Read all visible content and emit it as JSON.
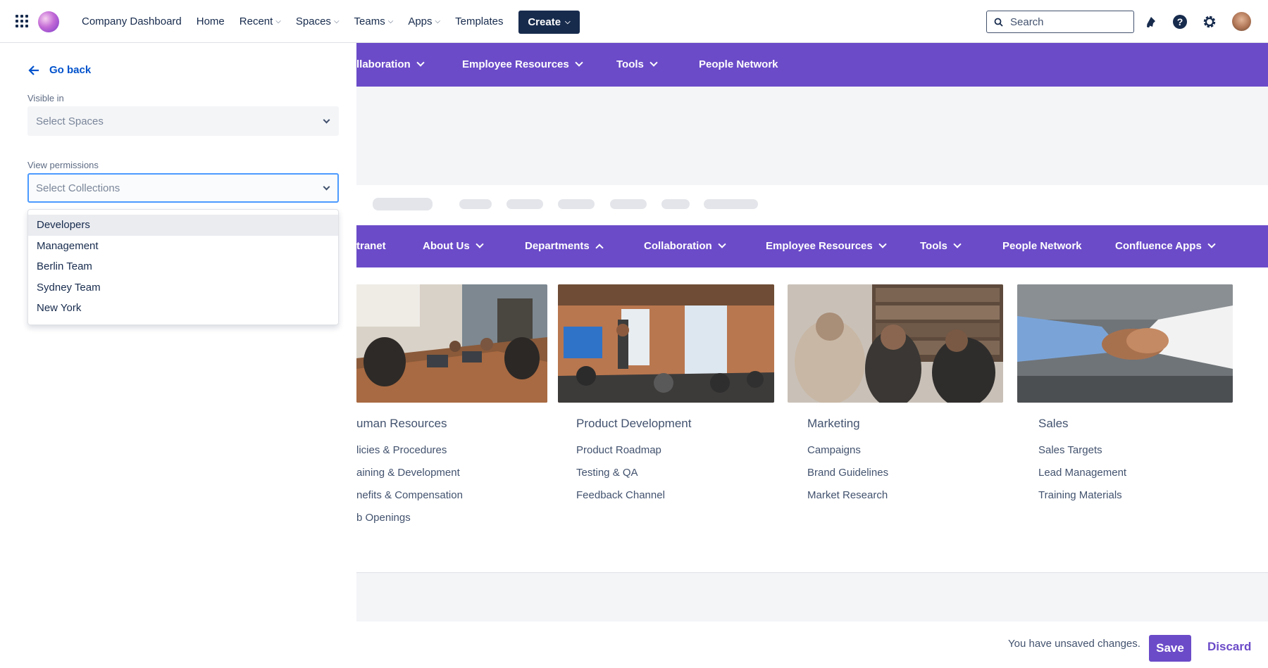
{
  "topbar": {
    "app_title": "Company Dashboard",
    "nav": [
      {
        "label": "Home",
        "dropdown": false
      },
      {
        "label": "Recent",
        "dropdown": true
      },
      {
        "label": "Spaces",
        "dropdown": true
      },
      {
        "label": "Teams",
        "dropdown": true
      },
      {
        "label": "Apps",
        "dropdown": true
      },
      {
        "label": "Templates",
        "dropdown": false
      }
    ],
    "create_label": "Create",
    "search_placeholder": "Search",
    "icons": [
      "apps-grid-icon",
      "notifications-icon",
      "help-icon",
      "settings-icon"
    ]
  },
  "panel": {
    "go_back": "Go back",
    "visible_in_label": "Visible in",
    "visible_in_placeholder": "Select Spaces",
    "view_permissions_label": "View permissions",
    "view_permissions_placeholder": "Select Collections",
    "options": [
      "Developers",
      "Management",
      "Berlin Team",
      "Sydney Team",
      "New York"
    ]
  },
  "preview": {
    "menu1": [
      "llaboration",
      "Employee Resources",
      "Tools",
      "People Network"
    ],
    "menu2": [
      "tranet",
      "About Us",
      "Departments",
      "Collaboration",
      "Employee Resources",
      "Tools",
      "People Network",
      "Confluence Apps"
    ],
    "cards": [
      {
        "title": "uman Resources",
        "links": [
          "licies & Procedures",
          "aining & Development",
          "nefits & Compensation",
          "b Openings"
        ]
      },
      {
        "title": "Product Development",
        "links": [
          "Product Roadmap",
          "Testing & QA",
          "Feedback Channel"
        ]
      },
      {
        "title": "Marketing",
        "links": [
          "Campaigns",
          "Brand Guidelines",
          "Market Research"
        ]
      },
      {
        "title": "Sales",
        "links": [
          "Sales Targets",
          "Lead Management",
          "Training Materials"
        ]
      }
    ]
  },
  "footer": {
    "unsaved": "You have unsaved changes.",
    "save": "Save",
    "discard": "Discard"
  },
  "colors": {
    "accent": "#6b4bc8",
    "primary_text": "#172b4d",
    "link": "#0052cc",
    "focus": "#4c9aff"
  }
}
